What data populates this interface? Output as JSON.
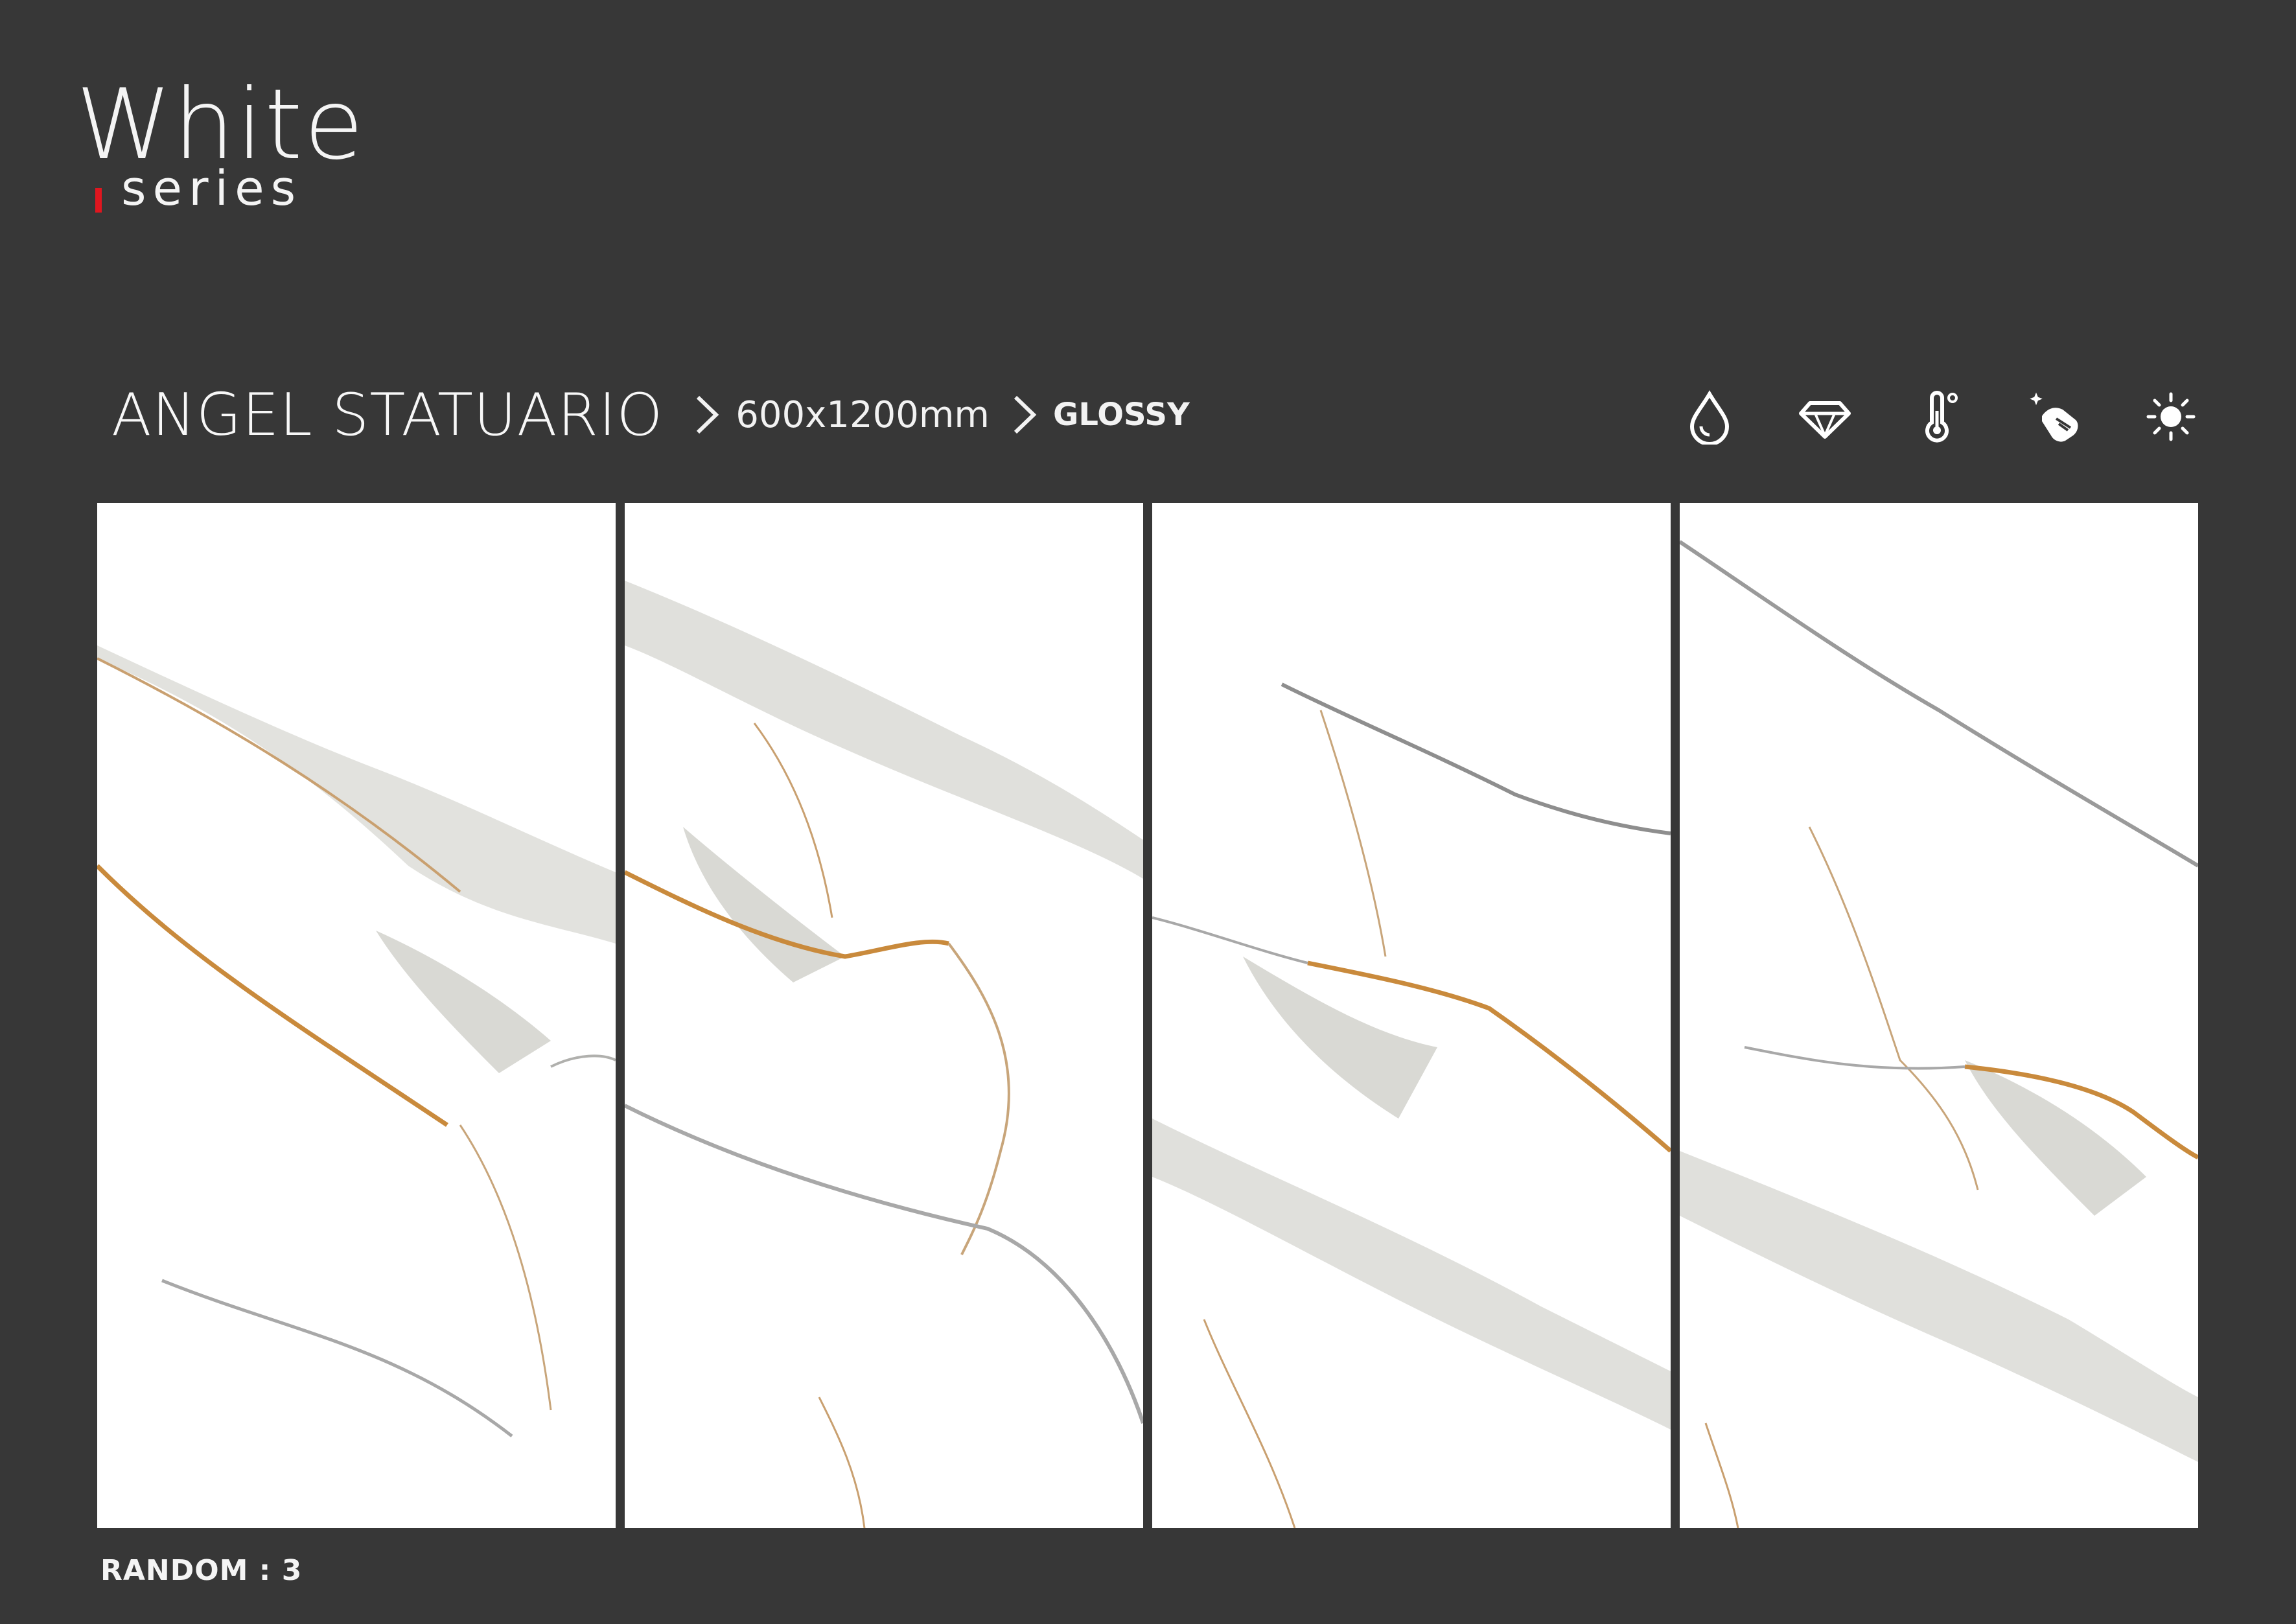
{
  "brand": {
    "title": "White",
    "subtitle": "series",
    "accent": "#e0161f"
  },
  "product": {
    "name": "ANGEL STATUARIO",
    "size": "600x1200mm",
    "finish": "GLOSSY"
  },
  "features": [
    {
      "icon": "water-drop-icon"
    },
    {
      "icon": "diamond-icon"
    },
    {
      "icon": "thermometer-icon"
    },
    {
      "icon": "easy-clean-hand-icon"
    },
    {
      "icon": "sun-icon"
    }
  ],
  "tiles": [
    {
      "name": "marble-tile-1"
    },
    {
      "name": "marble-tile-2"
    },
    {
      "name": "marble-tile-3"
    },
    {
      "name": "marble-tile-4"
    }
  ],
  "footer": {
    "random_label": "RANDOM : 3"
  },
  "colors": {
    "background": "#373737",
    "tile": "#ffffff",
    "vein_gold": "#c98a3c",
    "vein_grey": "#b9b9b2"
  }
}
